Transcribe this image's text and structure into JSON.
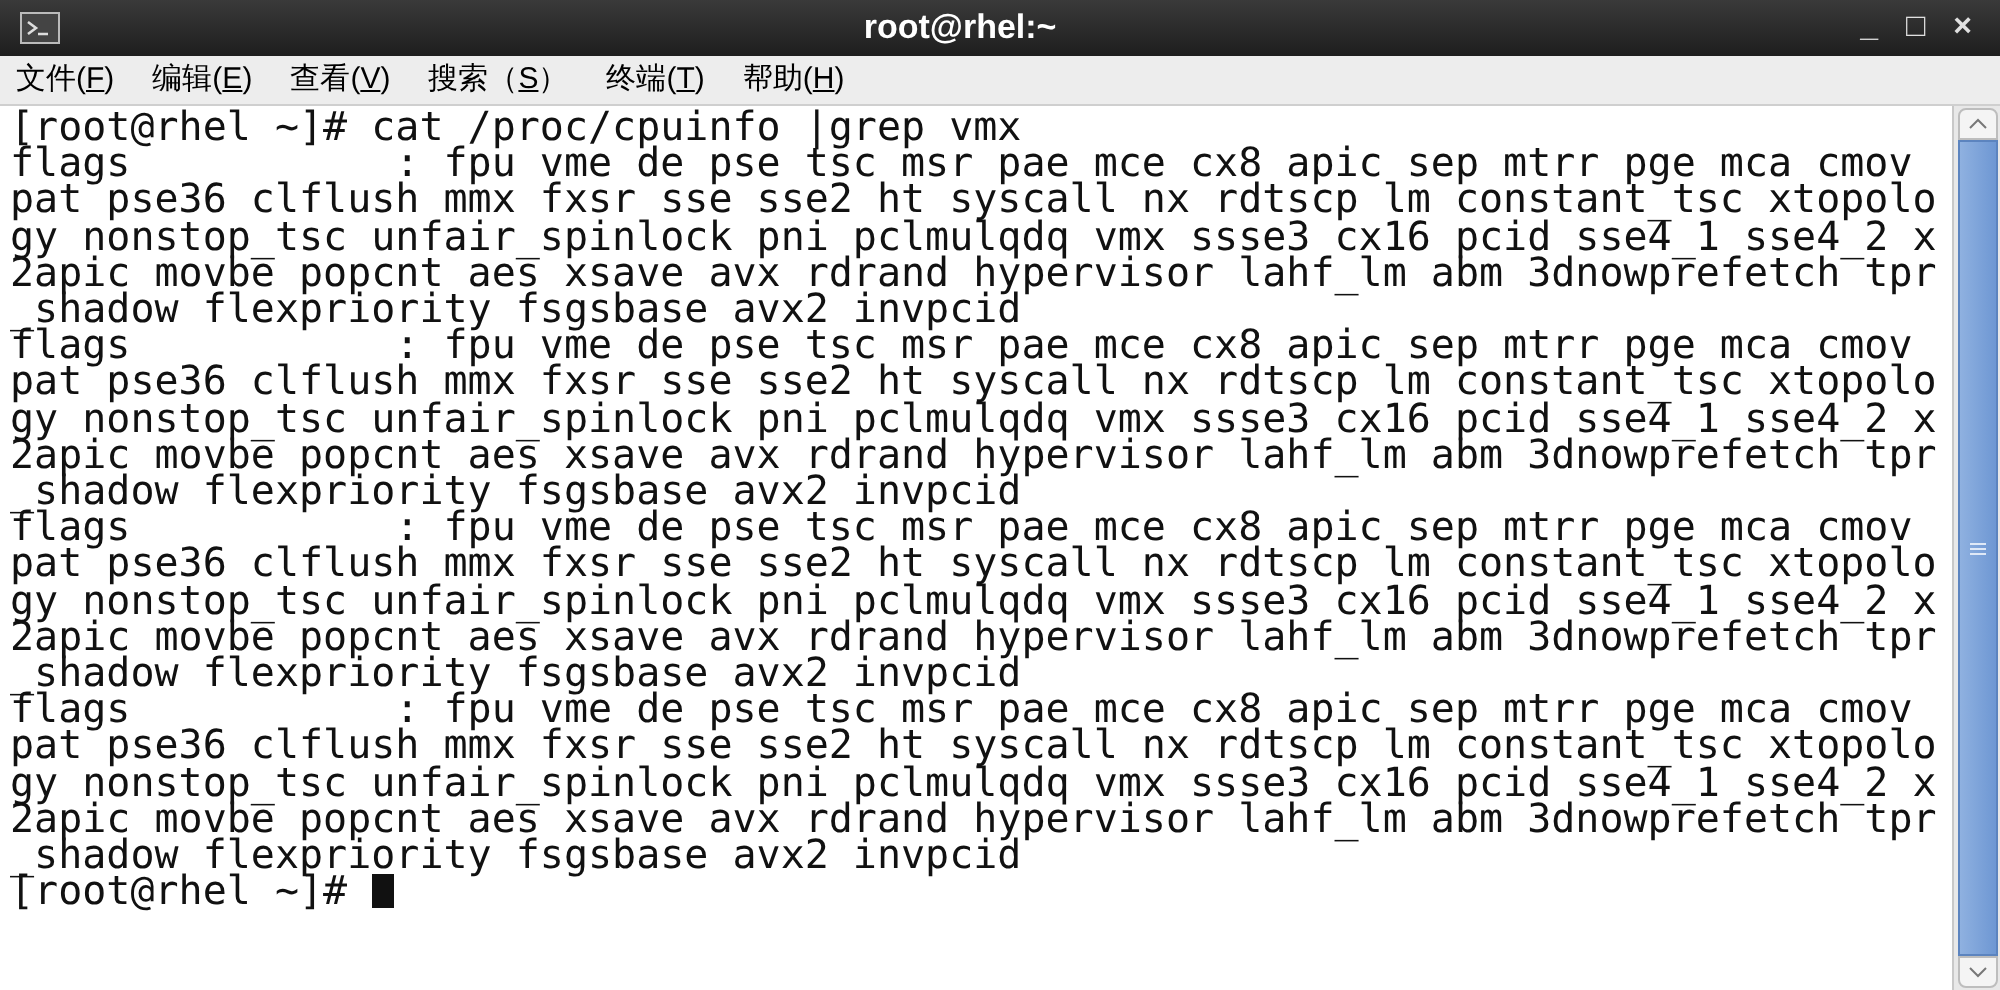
{
  "window": {
    "title": "root@rhel:~",
    "controls": [
      "_",
      "□",
      "×"
    ]
  },
  "menu": [
    {
      "before": "文件(",
      "key": "F",
      "after": ")"
    },
    {
      "before": "编辑(",
      "key": "E",
      "after": ")"
    },
    {
      "before": "查看(",
      "key": "V",
      "after": ")"
    },
    {
      "before": "搜索（",
      "key": "S",
      "after": "）"
    },
    {
      "before": "终端(",
      "key": "T",
      "after": ")"
    },
    {
      "before": "帮助(",
      "key": "H",
      "after": ")"
    }
  ],
  "terminal": {
    "lines": [
      "[root@rhel ~]# cat /proc/cpuinfo |grep vmx",
      "flags           : fpu vme de pse tsc msr pae mce cx8 apic sep mtrr pge mca cmov",
      "pat pse36 clflush mmx fxsr sse sse2 ht syscall nx rdtscp lm constant_tsc xtopolo",
      "gy nonstop_tsc unfair_spinlock pni pclmulqdq vmx ssse3 cx16 pcid sse4_1 sse4_2 x",
      "2apic movbe popcnt aes xsave avx rdrand hypervisor lahf_lm abm 3dnowprefetch tpr",
      "_shadow flexpriority fsgsbase avx2 invpcid",
      "flags           : fpu vme de pse tsc msr pae mce cx8 apic sep mtrr pge mca cmov",
      "pat pse36 clflush mmx fxsr sse sse2 ht syscall nx rdtscp lm constant_tsc xtopolo",
      "gy nonstop_tsc unfair_spinlock pni pclmulqdq vmx ssse3 cx16 pcid sse4_1 sse4_2 x",
      "2apic movbe popcnt aes xsave avx rdrand hypervisor lahf_lm abm 3dnowprefetch tpr",
      "_shadow flexpriority fsgsbase avx2 invpcid",
      "flags           : fpu vme de pse tsc msr pae mce cx8 apic sep mtrr pge mca cmov",
      "pat pse36 clflush mmx fxsr sse sse2 ht syscall nx rdtscp lm constant_tsc xtopolo",
      "gy nonstop_tsc unfair_spinlock pni pclmulqdq vmx ssse3 cx16 pcid sse4_1 sse4_2 x",
      "2apic movbe popcnt aes xsave avx rdrand hypervisor lahf_lm abm 3dnowprefetch tpr",
      "_shadow flexpriority fsgsbase avx2 invpcid",
      "flags           : fpu vme de pse tsc msr pae mce cx8 apic sep mtrr pge mca cmov",
      "pat pse36 clflush mmx fxsr sse sse2 ht syscall nx rdtscp lm constant_tsc xtopolo",
      "gy nonstop_tsc unfair_spinlock pni pclmulqdq vmx ssse3 cx16 pcid sse4_1 sse4_2 x",
      "2apic movbe popcnt aes xsave avx rdrand hypervisor lahf_lm abm 3dnowprefetch tpr",
      "_shadow flexpriority fsgsbase avx2 invpcid"
    ],
    "prompt": "[root@rhel ~]# "
  }
}
